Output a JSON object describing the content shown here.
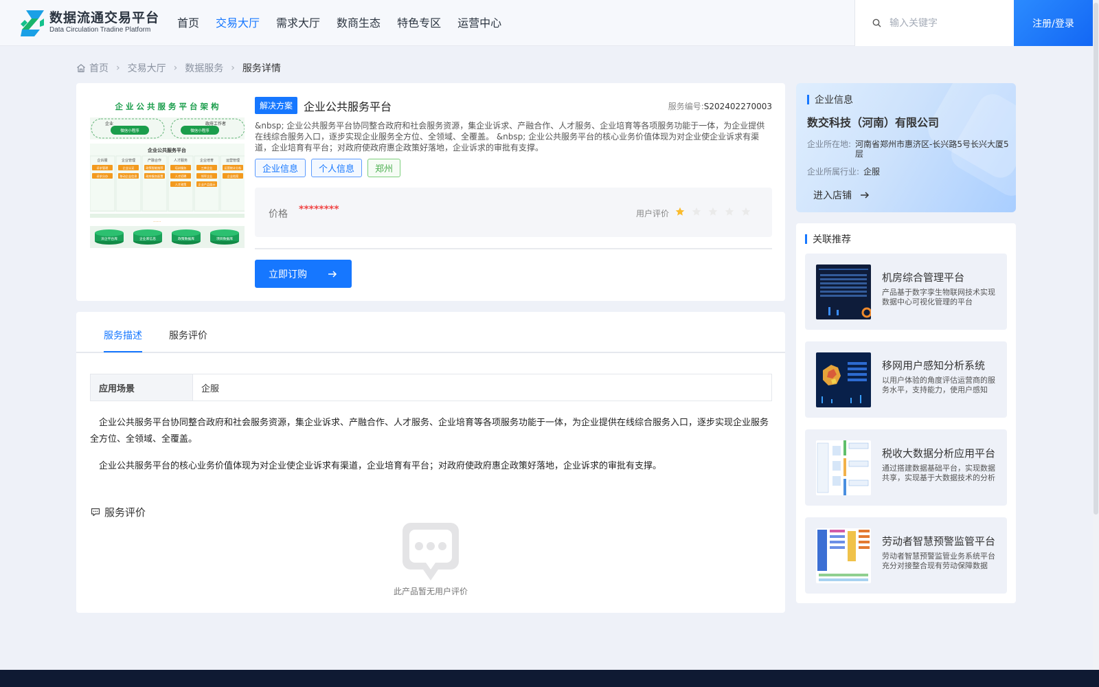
{
  "header": {
    "logo_title": "数据流通交易平台",
    "logo_subtitle": "Data Circulation Tradine Platform",
    "nav": [
      {
        "label": "首页"
      },
      {
        "label": "交易大厅"
      },
      {
        "label": "需求大厅"
      },
      {
        "label": "数商生态"
      },
      {
        "label": "特色专区"
      },
      {
        "label": "运营中心"
      }
    ],
    "active_nav": "交易大厅",
    "search_placeholder": "输入关键字",
    "login_label": "注册/登录"
  },
  "breadcrumb": {
    "home": "首页",
    "items": [
      "交易大厅",
      "数据服务"
    ],
    "current": "服务详情"
  },
  "product": {
    "badge": "解决方案",
    "title": "企业公共服务平台",
    "service_no_label": "服务编号:",
    "service_no": "S202402270003",
    "description": "&nbsp; 企业公共服务平台协同整合政府和社会服务资源，集企业诉求、产融合作、人才服务、企业培育等各项服务功能于一体，为企业提供在线综合服务入口，逐步实现企业服务全方位、全领域、全覆盖。 &nbsp; 企业公共服务平台的核心业务价值体现为对企业使企业诉求有渠道，企业培育有平台；对政府使政府惠企政策好落地，企业诉求的审批有支撑。",
    "tags": [
      "企业信息",
      "个人信息",
      "郑州"
    ],
    "price_label": "价格",
    "price_value": "********",
    "rating_label": "用户评价",
    "rating": 1,
    "rating_max": 5,
    "order_label": "立即订购",
    "image": {
      "title": "企 业 公 共 服 务 平 台 架 构",
      "row1_left": "企业",
      "row1_left_pill": "微信小程序",
      "row1_right": "政府工作者",
      "row1_right_pill": "微信小程序",
      "platform": "企业公共服务平台",
      "dots": "......",
      "columns": [
        {
          "head": "企诉服",
          "cells": [
            "诉求管理",
            "诉求分办"
          ]
        },
        {
          "head": "企业管理",
          "cells": [
            "企业认证",
            "移动企业信息"
          ]
        },
        {
          "head": "产融合作",
          "cells": [
            "政策智能推荐",
            "政府服务配置"
          ]
        },
        {
          "head": "人才服务",
          "cells": [
            "培训服务",
            "人才招聘",
            "人才政策"
          ]
        },
        {
          "head": "企业培育",
          "cells": [
            "三库企业",
            "领军企业",
            "企业产品展示"
          ]
        },
        {
          "head": "运营管理",
          "cells": [
            "运营统计分析",
            "企业档案"
          ]
        }
      ],
      "dbs": [
        "诉企平台库",
        "企业库信息",
        "政策数据库",
        "项目数据库"
      ]
    }
  },
  "detail": {
    "tabs": [
      "服务描述",
      "服务评价"
    ],
    "active_tab": "服务描述",
    "scene_key": "应用场景",
    "scene_value": "企服",
    "paragraphs": [
      "企业公共服务平台协同整合政府和社会服务资源，集企业诉求、产融合作、人才服务、企业培育等各项服务功能于一体，为企业提供在线综合服务入口，逐步实现企业服务全方位、全领域、全覆盖。",
      "企业公共服务平台的核心业务价值体现为对企业使企业诉求有渠道，企业培育有平台；对政府使政府惠企政策好落地，企业诉求的审批有支撑。"
    ],
    "review_title": "服务评价",
    "empty_text": "此产品暂无用户评价"
  },
  "company": {
    "section_title": "企业信息",
    "name": "数交科技（河南）有限公司",
    "location_label": "企业所在地:",
    "location": "河南省郑州市惠济区-长兴路5号长兴大厦5层",
    "industry_label": "企业所属行业:",
    "industry": "企服",
    "enter_shop": "进入店铺"
  },
  "recommend": {
    "section_title": "关联推荐",
    "items": [
      {
        "title": "机房综合管理平台",
        "desc": "产品基于数字孪生物联网技术实现数据中心可视化管理的平台"
      },
      {
        "title": "移网用户感知分析系统",
        "desc": "以用户体验的角度评估运营商的服务水平，支持能力，使用户感知"
      },
      {
        "title": "税收大数据分析应用平台",
        "desc": "通过搭建数据基础平台，实现数据共享，实现基于大数据技术的分析"
      },
      {
        "title": "劳动者智慧预警监管平台",
        "desc": "劳动者智慧预警监管业务系统平台充分对接整合现有劳动保障数据"
      }
    ]
  },
  "colors": {
    "primary": "#1677ff",
    "price": "#f04747",
    "star": "#fabb2d",
    "footer": "#0f1a33"
  }
}
